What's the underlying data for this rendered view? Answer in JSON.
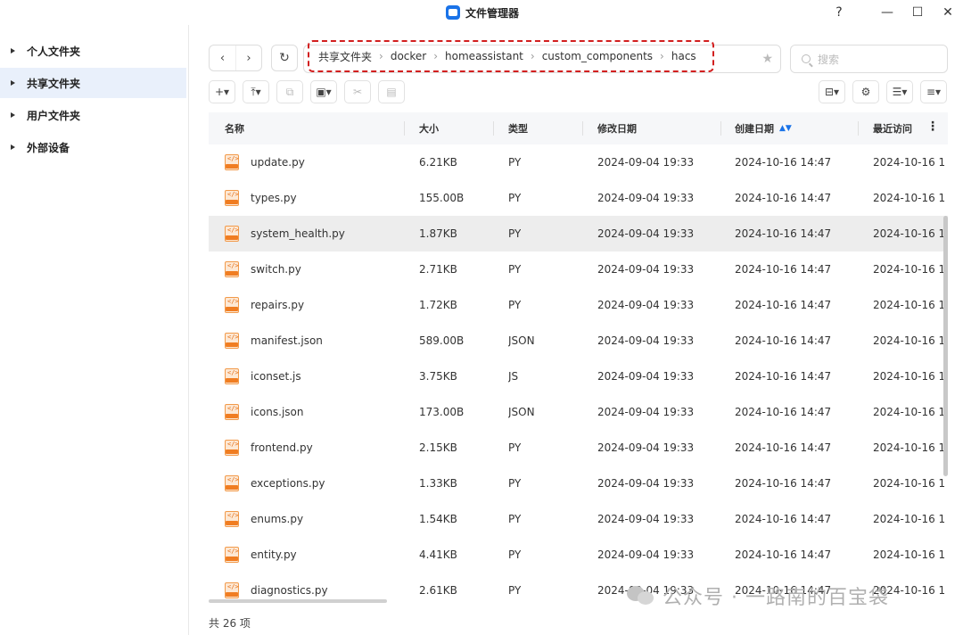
{
  "window": {
    "title": "文件管理器",
    "help": "?",
    "minimize": "—",
    "maximize": "☐",
    "close": "✕"
  },
  "sidebar": {
    "items": [
      {
        "label": "个人文件夹",
        "active": false
      },
      {
        "label": "共享文件夹",
        "active": true
      },
      {
        "label": "用户文件夹",
        "active": false
      },
      {
        "label": "外部设备",
        "active": false
      }
    ]
  },
  "nav": {
    "back": "‹",
    "forward": "›",
    "refresh": "↻"
  },
  "breadcrumb": [
    "共享文件夹",
    "docker",
    "homeassistant",
    "custom_components",
    "hacs"
  ],
  "search": {
    "placeholder": "搜索"
  },
  "table": {
    "columns": {
      "name": "名称",
      "size": "大小",
      "type": "类型",
      "modified": "修改日期",
      "created": "创建日期",
      "accessed": "最近访问"
    },
    "rows": [
      {
        "name": "update.py",
        "size": "6.21KB",
        "type": "PY",
        "modified": "2024-09-04 19:33",
        "created": "2024-10-16 14:47",
        "accessed": "2024-10-16 1"
      },
      {
        "name": "types.py",
        "size": "155.00B",
        "type": "PY",
        "modified": "2024-09-04 19:33",
        "created": "2024-10-16 14:47",
        "accessed": "2024-10-16 1"
      },
      {
        "name": "system_health.py",
        "size": "1.87KB",
        "type": "PY",
        "modified": "2024-09-04 19:33",
        "created": "2024-10-16 14:47",
        "accessed": "2024-10-16 1"
      },
      {
        "name": "switch.py",
        "size": "2.71KB",
        "type": "PY",
        "modified": "2024-09-04 19:33",
        "created": "2024-10-16 14:47",
        "accessed": "2024-10-16 1"
      },
      {
        "name": "repairs.py",
        "size": "1.72KB",
        "type": "PY",
        "modified": "2024-09-04 19:33",
        "created": "2024-10-16 14:47",
        "accessed": "2024-10-16 1"
      },
      {
        "name": "manifest.json",
        "size": "589.00B",
        "type": "JSON",
        "modified": "2024-09-04 19:33",
        "created": "2024-10-16 14:47",
        "accessed": "2024-10-16 1"
      },
      {
        "name": "iconset.js",
        "size": "3.75KB",
        "type": "JS",
        "modified": "2024-09-04 19:33",
        "created": "2024-10-16 14:47",
        "accessed": "2024-10-16 1"
      },
      {
        "name": "icons.json",
        "size": "173.00B",
        "type": "JSON",
        "modified": "2024-09-04 19:33",
        "created": "2024-10-16 14:47",
        "accessed": "2024-10-16 1"
      },
      {
        "name": "frontend.py",
        "size": "2.15KB",
        "type": "PY",
        "modified": "2024-09-04 19:33",
        "created": "2024-10-16 14:47",
        "accessed": "2024-10-16 1"
      },
      {
        "name": "exceptions.py",
        "size": "1.33KB",
        "type": "PY",
        "modified": "2024-09-04 19:33",
        "created": "2024-10-16 14:47",
        "accessed": "2024-10-16 1"
      },
      {
        "name": "enums.py",
        "size": "1.54KB",
        "type": "PY",
        "modified": "2024-09-04 19:33",
        "created": "2024-10-16 14:47",
        "accessed": "2024-10-16 1"
      },
      {
        "name": "entity.py",
        "size": "4.41KB",
        "type": "PY",
        "modified": "2024-09-04 19:33",
        "created": "2024-10-16 14:47",
        "accessed": "2024-10-16 1"
      },
      {
        "name": "diagnostics.py",
        "size": "2.61KB",
        "type": "PY",
        "modified": "2024-09-04 19:33",
        "created": "2024-10-16 14:47",
        "accessed": "2024-10-16 1"
      }
    ],
    "highlighted_row": 2
  },
  "footer": {
    "count": "共 26 项"
  },
  "watermark": {
    "text": "公众号 · 一路南的百宝袋"
  },
  "colors": {
    "accent": "#1a73e8",
    "highlight_border": "#d21f1f",
    "file_icon": "#f07d22"
  }
}
